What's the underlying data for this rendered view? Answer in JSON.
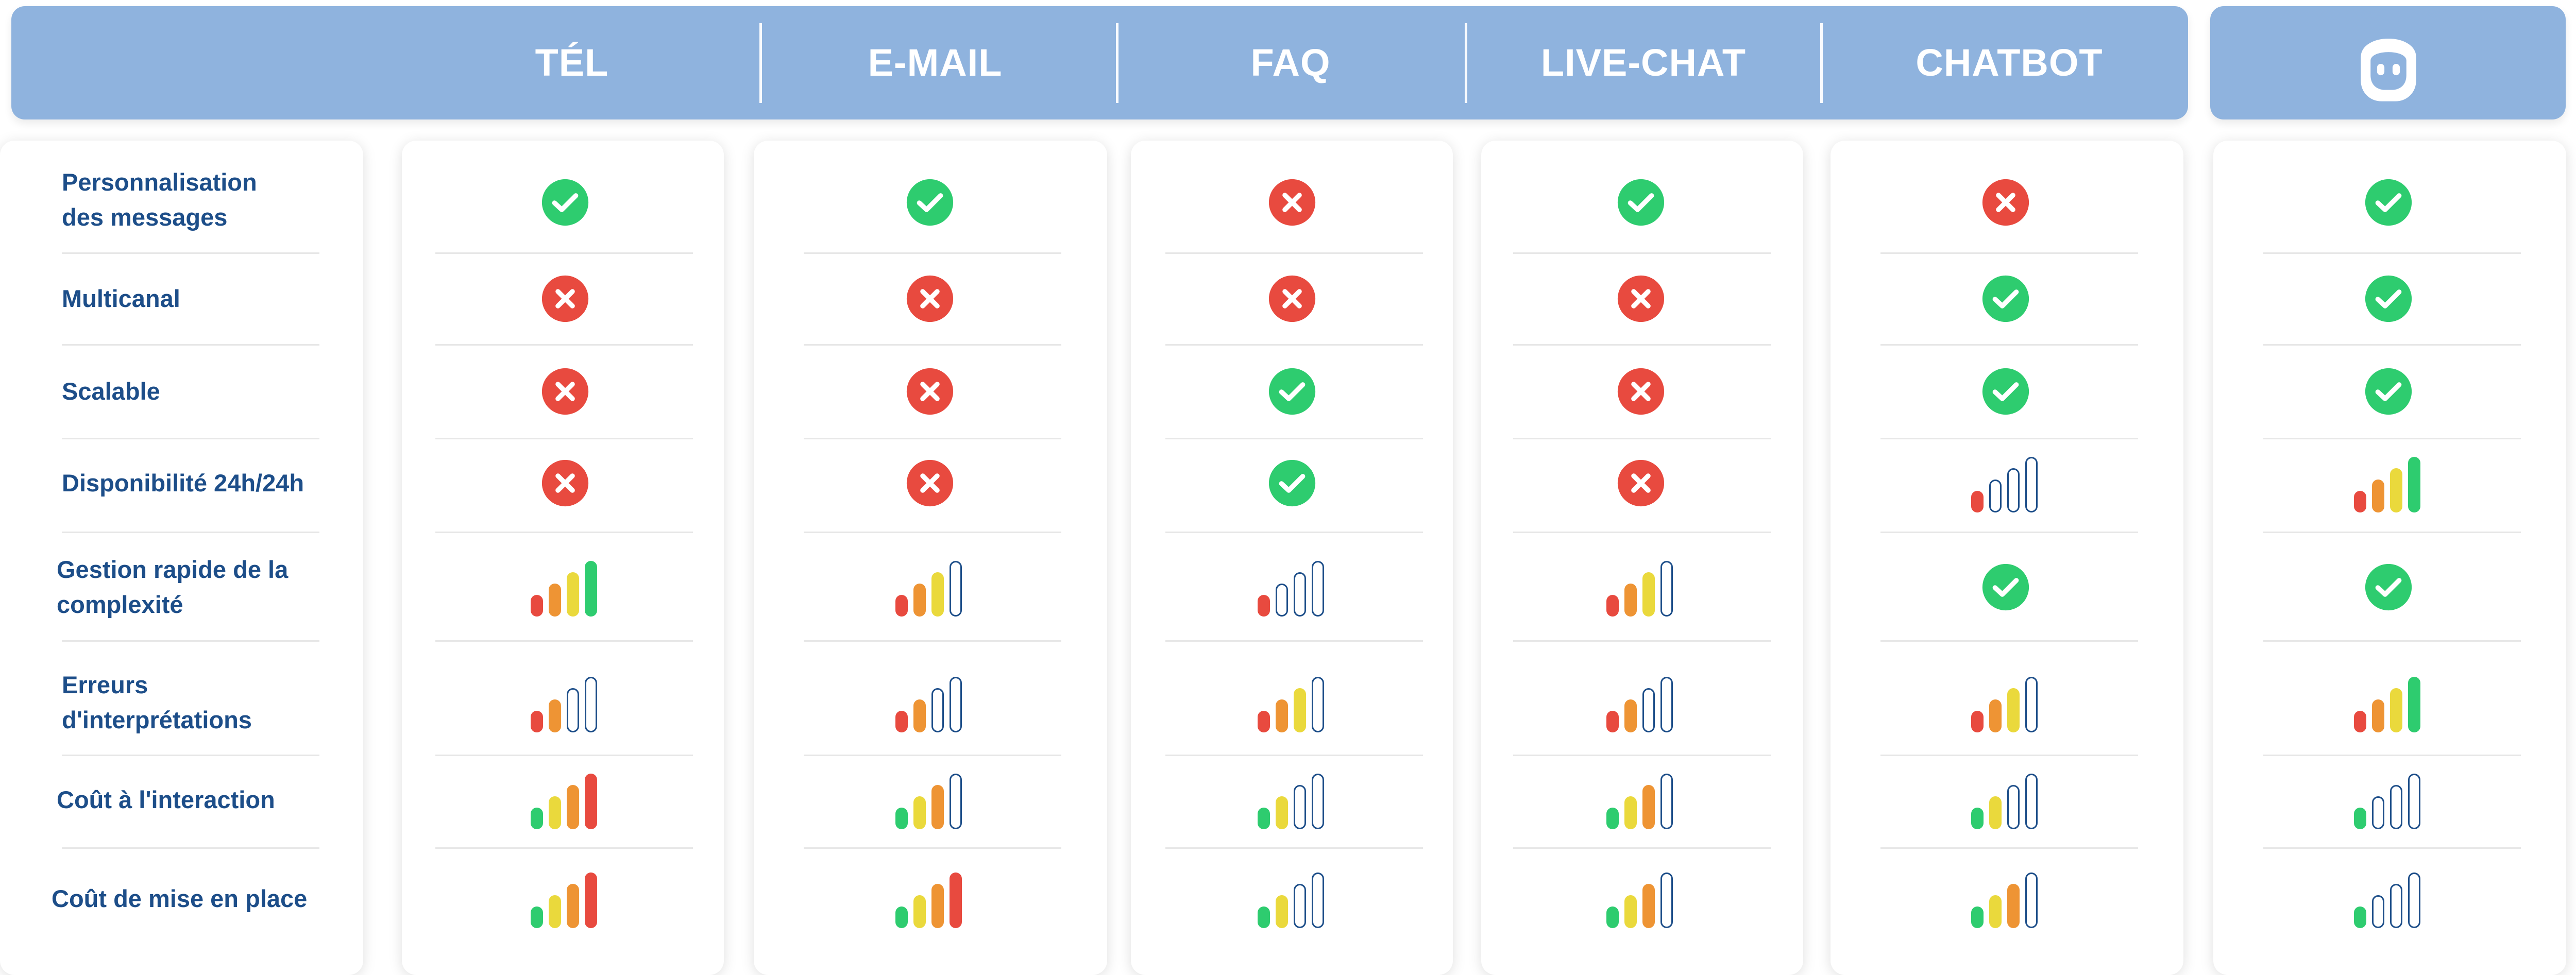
{
  "header": {
    "columns": [
      "TÉL",
      "E-MAIL",
      "FAQ",
      "LIVE-CHAT",
      "CHATBOT"
    ],
    "last_column_icon": "robot-icon"
  },
  "rows": [
    {
      "label": "Personnalisation\ndes messages",
      "values": [
        "check",
        "check",
        "cross",
        "check",
        "cross",
        "check"
      ]
    },
    {
      "label": "Multicanal",
      "values": [
        "cross",
        "cross",
        "cross",
        "cross",
        "check",
        "check"
      ]
    },
    {
      "label": "Scalable",
      "values": [
        "cross",
        "cross",
        "check",
        "cross",
        "check",
        "check"
      ]
    },
    {
      "label": "Disponibilité 24h/24h",
      "values": [
        "cross",
        "cross",
        "check",
        "cross",
        "bars-1-up",
        "bars-4-up"
      ]
    },
    {
      "label": "Gestion rapide de la\ncomplexité",
      "values": [
        "bars-4-up",
        "bars-3-up",
        "bars-1-up",
        "bars-3-up",
        "check",
        "check"
      ]
    },
    {
      "label": "Erreurs\nd'interprétations",
      "values": [
        "bars-2-up",
        "bars-2-up",
        "bars-3-up",
        "bars-2-up",
        "bars-3-up",
        "bars-4-up"
      ]
    },
    {
      "label": "Coût à l'interaction",
      "values": [
        "bars-4-down",
        "bars-3-down",
        "bars-2-down",
        "bars-3-down",
        "bars-2-down",
        "bars-1-down"
      ]
    },
    {
      "label": "Coût de mise en place",
      "values": [
        "bars-4-down",
        "bars-4-down",
        "bars-2-down",
        "bars-3-down",
        "bars-3-down",
        "bars-1-down"
      ]
    }
  ],
  "colors": {
    "header_bg": "#8fb3de",
    "label_text": "#1d4e89",
    "check": "#2ecc6f",
    "cross": "#e84a3f",
    "bar_red": "#e84a3f",
    "bar_orange": "#ee9434",
    "bar_yellow": "#ead93c",
    "bar_green": "#2ecc6f",
    "bar_empty_outline": "#1d4e89"
  }
}
